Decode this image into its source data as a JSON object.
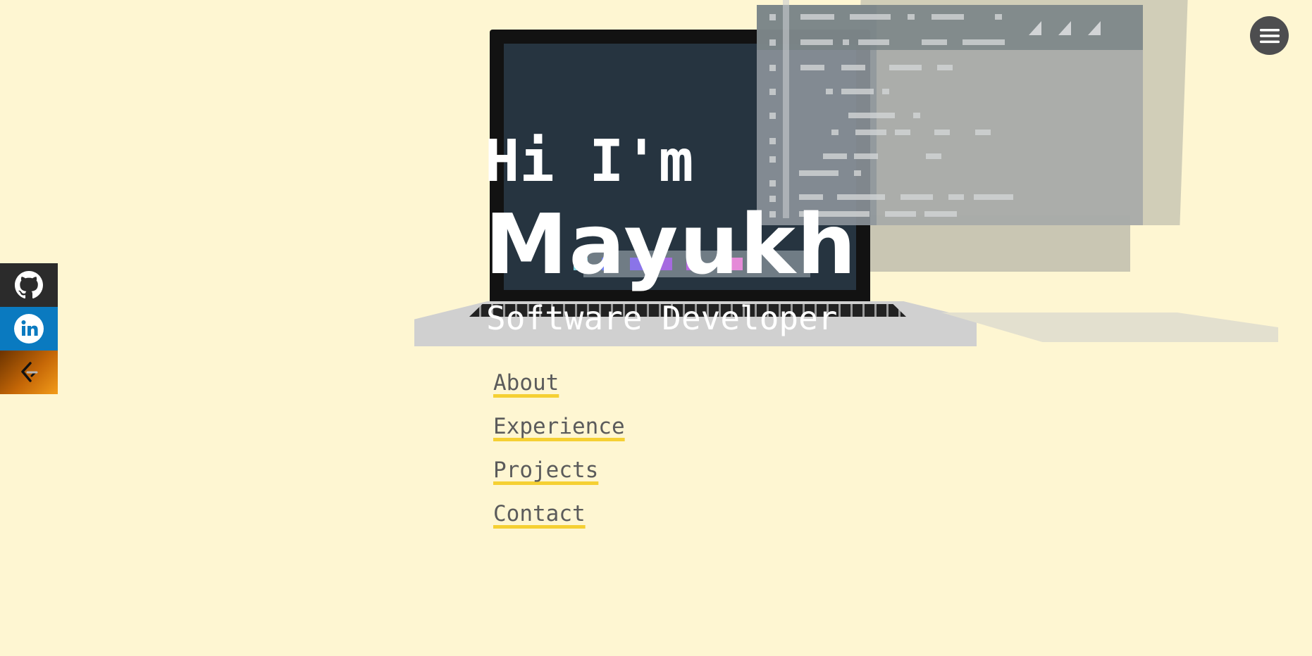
{
  "hero": {
    "greeting": "Hi I'm",
    "name": "Mayukh",
    "role": "Software Developer"
  },
  "nav": {
    "items": [
      {
        "label": "About"
      },
      {
        "label": "Experience"
      },
      {
        "label": "Projects"
      },
      {
        "label": "Contact"
      }
    ]
  },
  "social": {
    "items": [
      {
        "icon": "github-icon",
        "color": "#2b2b2b"
      },
      {
        "icon": "linkedin-icon",
        "color": "#0a7ac0"
      },
      {
        "icon": "leetcode-icon",
        "color": "#f39c1a"
      }
    ]
  },
  "menu": {
    "icon": "hamburger-menu-icon"
  },
  "colors": {
    "background": "#fef6d2",
    "link_underline": "#f5d033",
    "link_text": "#5b5b5b",
    "hero_text": "#ffffff"
  }
}
